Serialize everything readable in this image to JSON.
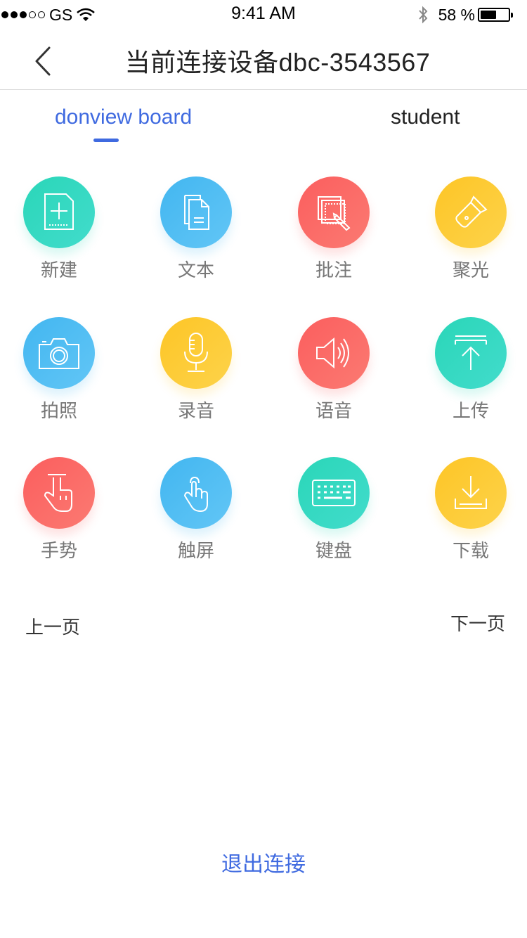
{
  "status_bar": {
    "carrier": "GS",
    "time": "9:41 AM",
    "battery": "58 %",
    "battery_level": 0.58
  },
  "header": {
    "title": "当前连接设备dbc-3543567"
  },
  "tabs": [
    {
      "label": "donview board",
      "active": true
    },
    {
      "label": "student",
      "active": false
    }
  ],
  "functions": [
    {
      "label": "新建",
      "icon": "new-file-icon",
      "color": "#2ad6b8"
    },
    {
      "label": "文本",
      "icon": "document-icon",
      "color": "#42b6f0"
    },
    {
      "label": "批注",
      "icon": "annotate-icon",
      "color": "#fb5e5e"
    },
    {
      "label": "聚光",
      "icon": "flashlight-icon",
      "color": "#fdc526"
    },
    {
      "label": "拍照",
      "icon": "camera-icon",
      "color": "#42b6f0"
    },
    {
      "label": "录音",
      "icon": "microphone-icon",
      "color": "#fdc526"
    },
    {
      "label": "语音",
      "icon": "speaker-icon",
      "color": "#fb5e5e"
    },
    {
      "label": "上传",
      "icon": "upload-icon",
      "color": "#2ad6b8"
    },
    {
      "label": "手势",
      "icon": "gesture-icon",
      "color": "#fb5e5e"
    },
    {
      "label": "触屏",
      "icon": "touch-icon",
      "color": "#42b6f0"
    },
    {
      "label": "键盘",
      "icon": "keyboard-icon",
      "color": "#2ad6b8"
    },
    {
      "label": "下载",
      "icon": "download-icon",
      "color": "#fdc526"
    }
  ],
  "pagination": {
    "prev": "上一页",
    "next": "下一页"
  },
  "disconnect_label": "退出连接",
  "colors": {
    "accent": "#3f6ae0",
    "teal": "#2ad6b8",
    "blue": "#42b6f0",
    "red": "#fb5e5e",
    "yellow": "#fdc526"
  }
}
